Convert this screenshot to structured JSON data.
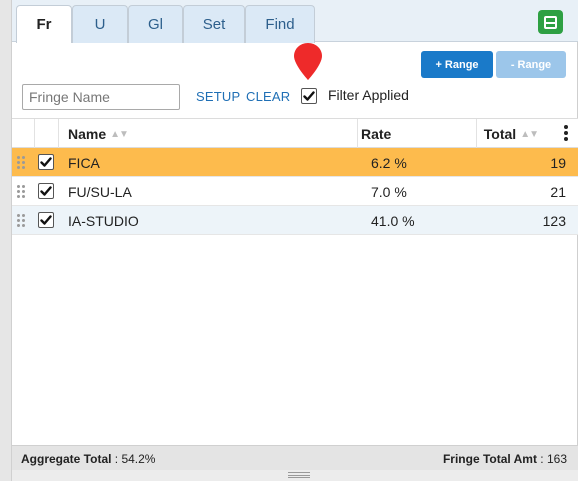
{
  "tabs": [
    {
      "label": "Fr",
      "active": true
    },
    {
      "label": "U",
      "active": false
    },
    {
      "label": "Gl",
      "active": false
    },
    {
      "label": "Set",
      "active": false
    },
    {
      "label": "Find",
      "active": false
    }
  ],
  "toolbar": {
    "add_range_label": "+ Range",
    "remove_range_label": "- Range",
    "panel_icon": "panel-layout-icon",
    "panel_icon_color": "#2ea043"
  },
  "filter": {
    "placeholder": "Fringe Name",
    "value": "",
    "setup_label": "SETUP",
    "clear_label": "CLEAR",
    "applied_label": "Filter Applied",
    "applied_checked": true
  },
  "table": {
    "columns": {
      "name": "Name",
      "rate": "Rate",
      "total": "Total"
    },
    "rows": [
      {
        "checked": true,
        "name": "FICA",
        "rate": "6.2 %",
        "total": "19",
        "selected": true
      },
      {
        "checked": true,
        "name": "FU/SU-LA",
        "rate": "7.0 %",
        "total": "21",
        "selected": false
      },
      {
        "checked": true,
        "name": "IA-STUDIO",
        "rate": "41.0 %",
        "total": "123",
        "selected": false
      }
    ]
  },
  "footer": {
    "aggregate_label": "Aggregate Total",
    "aggregate_value": " : 54.2%",
    "fringe_total_label": "Fringe Total Amt",
    "fringe_total_value": ": 163"
  },
  "colors": {
    "accent_blue": "#1a7ac9",
    "selected_row": "#fdbb4d",
    "marker_red": "#ee2a2a"
  }
}
